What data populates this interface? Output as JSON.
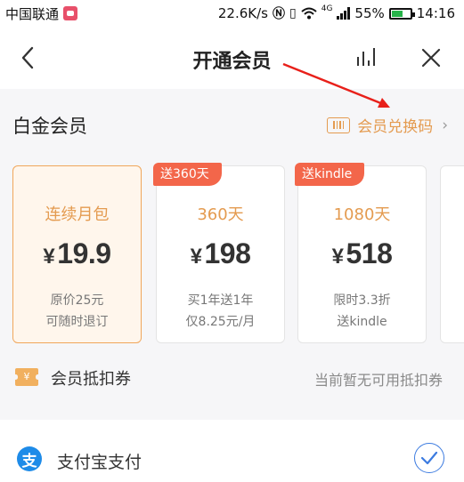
{
  "status_bar": {
    "carrier": "中国联通",
    "network_speed": "22.6K/s",
    "network_type": "4G",
    "battery": "55%",
    "time": "14:16"
  },
  "nav": {
    "title": "开通会员",
    "icons": [
      "back-icon",
      "stats-icon",
      "close-icon"
    ]
  },
  "member": {
    "type_label": "白金会员",
    "redeem_label": "会员兑换码",
    "redeem_chevron": "›"
  },
  "plans": [
    {
      "name": "连续月包",
      "currency": "¥",
      "price": "19.9",
      "note_line1": "原价25元",
      "note_line2": "可随时退订",
      "badge": "",
      "selected": true
    },
    {
      "name": "360天",
      "currency": "¥",
      "price": "198",
      "note_line1": "买1年送1年",
      "note_line2": "仅8.25元/月",
      "badge": "送360天",
      "selected": false
    },
    {
      "name": "1080天",
      "currency": "¥",
      "price": "518",
      "note_line1": "限时3.3折",
      "note_line2": "送kindle",
      "badge": "送kindle",
      "selected": false
    }
  ],
  "coupon": {
    "icon_text": "¥",
    "label": "会员抵扣券",
    "status": "当前暂无可用抵扣券"
  },
  "payment": {
    "icon_text": "支",
    "label": "支付宝支付",
    "selected": true
  },
  "colors": {
    "accent": "#e49b50",
    "badge": "#f3664a",
    "selected_bg": "#fff6ec",
    "alipay": "#1e8be8",
    "check": "#3c7be0",
    "annotation_arrow": "#e8201a"
  }
}
